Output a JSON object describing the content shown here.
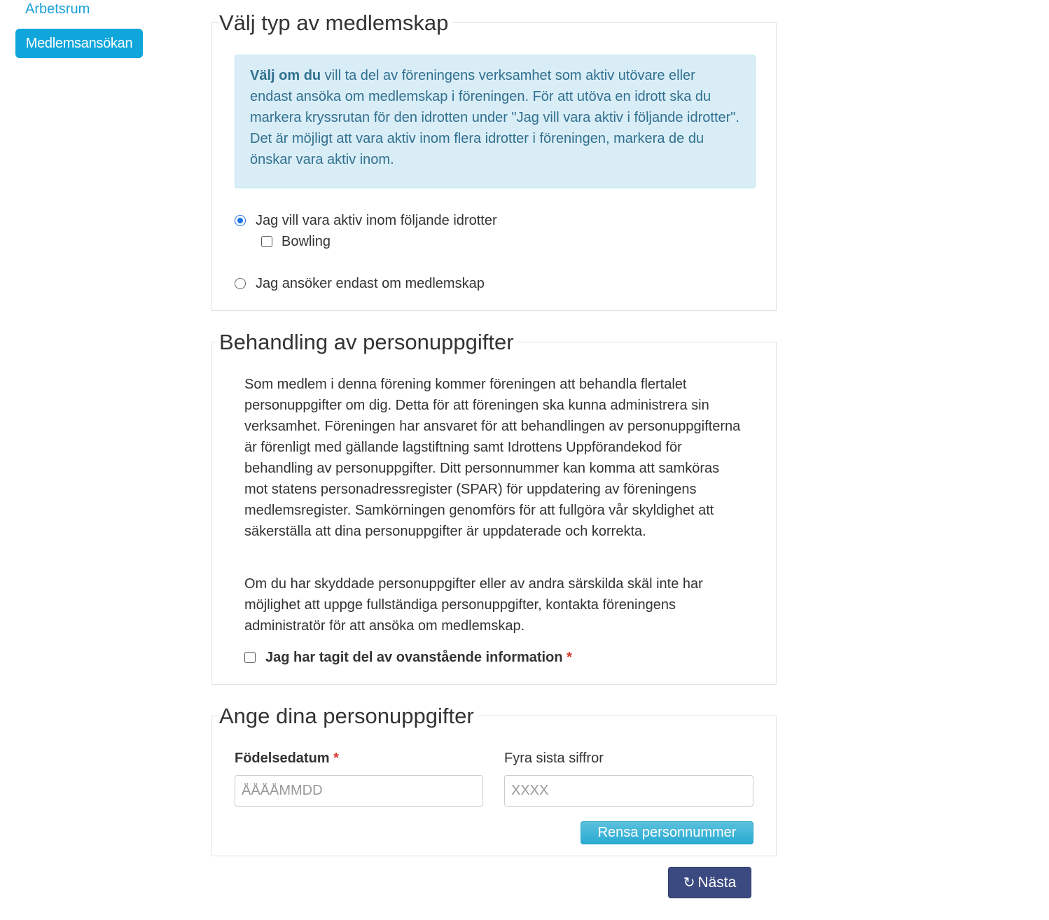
{
  "nav": {
    "workspace_link": "Arbetsrum",
    "active_item": "Medlemsansökan"
  },
  "membership": {
    "legend": "Välj typ av medlemskap",
    "info_bold": "Välj om du",
    "info_text": " vill ta del av föreningens verksamhet som aktiv utövare eller endast ansöka om medlemskap i föreningen. För att utöva en idrott ska du markera kryssrutan för den idrotten under \"Jag vill vara aktiv i följande idrotter\". Det är möjligt att vara aktiv inom flera idrotter i föreningen, markera de du önskar vara aktiv inom.",
    "option_active": "Jag vill vara aktiv inom följande idrotter",
    "option_active_selected": true,
    "sports": [
      {
        "label": "Bowling",
        "checked": false
      }
    ],
    "option_member_only": "Jag ansöker endast om medlemskap",
    "option_member_only_selected": false
  },
  "privacy": {
    "legend": "Behandling av personuppgifter",
    "paragraph1": "Som medlem i denna förening kommer föreningen att behandla flertalet personuppgifter om dig. Detta för att föreningen ska kunna administrera sin verksamhet. Föreningen har ansvaret för att behandlingen av personuppgifterna är förenligt med gällande lagstiftning samt Idrottens Uppförandekod för behandling av personuppgifter. Ditt personnummer kan komma att samköras mot statens personadressregister (SPAR) för uppdatering av föreningens medlemsregister. Samkörningen genomförs för att fullgöra vår skyldighet att säkerställa att dina personuppgifter är uppdaterade och korrekta.",
    "paragraph2": "Om du har skyddade personuppgifter eller av andra särskilda skäl inte har möjlighet att uppge fullständiga personuppgifter, kontakta föreningens administratör för att ansöka om medlemskap.",
    "consent_label": "Jag har tagit del av ovanstående information",
    "required_mark": "*",
    "consent_checked": false
  },
  "personal": {
    "legend": "Ange dina personuppgifter",
    "birthdate_label": "Födelsedatum",
    "required_mark": "*",
    "birthdate_placeholder": "ÅÅÅÅMMDD",
    "birthdate_value": "",
    "last_four_label": "Fyra sista siffror",
    "last_four_placeholder": "XXXX",
    "last_four_value": "",
    "clear_button": "Rensa personnummer"
  },
  "next_button": "Nästa",
  "next_icon": "refresh-icon",
  "colors": {
    "accent": "#10a6dc",
    "info_bg": "#d9edf7",
    "info_text": "#31708f",
    "next_button": "#3b4a80",
    "required": "#d9372d"
  }
}
